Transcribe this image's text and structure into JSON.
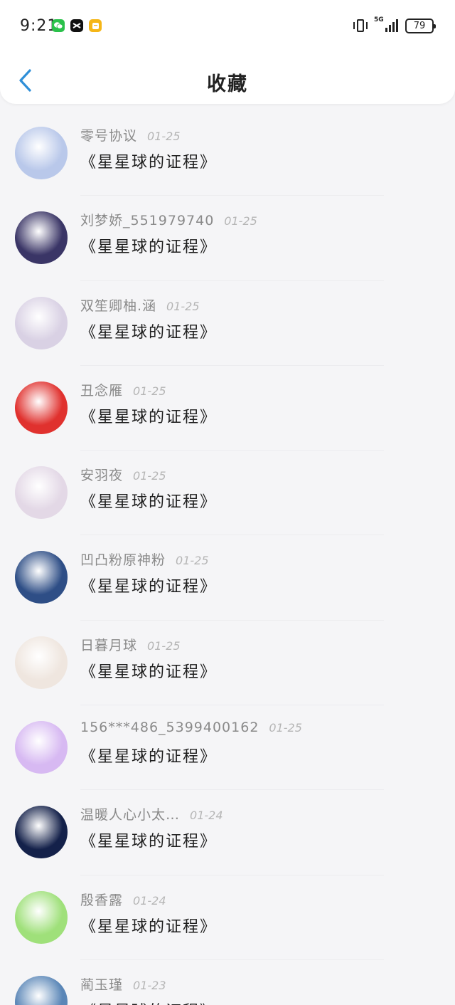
{
  "status_bar": {
    "time": "9:21",
    "network": "5G",
    "battery": "79",
    "icons": [
      "wechat-icon",
      "capcut-icon",
      "notes-icon",
      "vibrate-icon",
      "signal-icon",
      "battery-icon"
    ]
  },
  "header": {
    "title": "收藏",
    "back_icon": "chevron-left-icon",
    "accent_color": "#2f8fd8"
  },
  "favorites": [
    {
      "user": "零号协议",
      "date": "01-25",
      "title": "《星星球的证程》",
      "avatar_color": "#b9c8ea"
    },
    {
      "user": "刘梦娇_551979740",
      "date": "01-25",
      "title": "《星星球的证程》",
      "avatar_color": "#3a3566"
    },
    {
      "user": "双笙卿柚.涵",
      "date": "01-25",
      "title": "《星星球的证程》",
      "avatar_color": "#d9d1e4"
    },
    {
      "user": "丑念雁",
      "date": "01-25",
      "title": "《星星球的证程》",
      "avatar_color": "#e0312e"
    },
    {
      "user": "安羽夜",
      "date": "01-25",
      "title": "《星星球的证程》",
      "avatar_color": "#e3d8e6"
    },
    {
      "user": "凹凸粉原神粉",
      "date": "01-25",
      "title": "《星星球的证程》",
      "avatar_color": "#2e4e86"
    },
    {
      "user": "日暮月球",
      "date": "01-25",
      "title": "《星星球的证程》",
      "avatar_color": "#efe6df"
    },
    {
      "user": "156***486_5399400162",
      "date": "01-25",
      "title": "《星星球的证程》",
      "avatar_color": "#d7b9f2"
    },
    {
      "user": "温暖人心小太…",
      "date": "01-24",
      "title": "《星星球的证程》",
      "avatar_color": "#14214a"
    },
    {
      "user": "殷香露",
      "date": "01-24",
      "title": "《星星球的证程》",
      "avatar_color": "#9fe07a"
    },
    {
      "user": "蔺玉瑾",
      "date": "01-23",
      "title": "《星星球的证程》",
      "avatar_color": "#5a86b7"
    }
  ]
}
